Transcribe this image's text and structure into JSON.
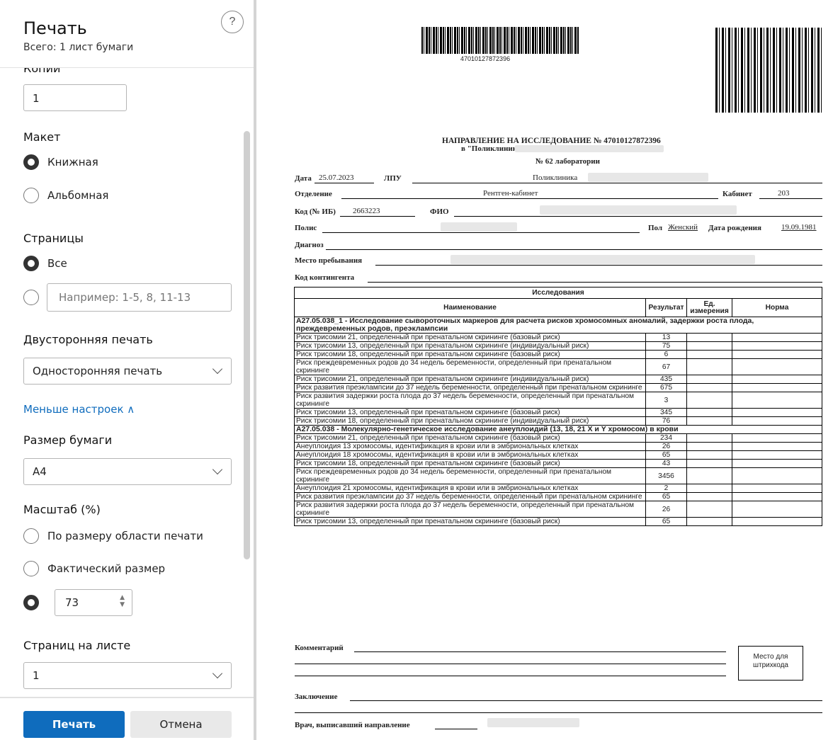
{
  "dialog": {
    "title": "Печать",
    "subtitle": "Всего: 1 лист бумаги",
    "help": "?",
    "copies_label": "Копии",
    "copies_value": "1",
    "layout_label": "Макет",
    "layout_options": [
      "Книжная",
      "Альбомная"
    ],
    "pages_label": "Страницы",
    "pages_all": "Все",
    "pages_placeholder": "Например: 1-5, 8, 11-13",
    "duplex_label": "Двусторонняя печать",
    "duplex_value": "Односторонняя печать",
    "less_settings": "Меньше настроек ∧",
    "paper_label": "Размер бумаги",
    "paper_value": "A4",
    "scale_label": "Масштаб (%)",
    "scale_fit": "По размеру области печати",
    "scale_actual": "Фактический размер",
    "scale_value": "73",
    "pps_label": "Страниц на листе",
    "pps_value": "1",
    "print_button": "Печать",
    "cancel_button": "Отмена"
  },
  "document": {
    "barcode_number": "47010127872396",
    "heading": "НАПРАВЛЕНИЕ НА ИССЛЕДОВАНИЕ № 47010127872396",
    "heading_to": "в \"Поликлиника",
    "lab": "№ 62 лаборатории",
    "date_label": "Дата",
    "date_value": "25.07.2023",
    "lpu_label": "ЛПУ",
    "lpu_value": "Поликлиника",
    "dept_label": "Отделение",
    "dept_value": "Рентген-кабинет",
    "cabinet_label": "Кабинет",
    "cabinet_value": "203",
    "code_label": "Код (№ ИБ)",
    "code_value": "2663223",
    "fio_label": "ФИО",
    "policy_label": "Полис",
    "sex_label": "Пол",
    "sex_value": "Женский",
    "dob_label": "Дата рождения",
    "dob_value": "19.09.1981",
    "diagnosis_label": "Диагноз",
    "stay_label": "Место пребывания",
    "contingent_label": "Код контингента",
    "table_title": "Исследования",
    "col_name": "Наименование",
    "col_result": "Результат",
    "col_unit": "Ед. измерения",
    "col_norm": "Норма",
    "groups": [
      {
        "title": "A27.05.038_1 - Исследование сывороточных маркеров для расчета рисков хромосомных аномалий, задержки роста плода, преждевременных родов, преэклампсии",
        "rows": [
          {
            "name": "Риск трисомии 21, определенный при пренатальном скрининге (базовый риск)",
            "result": "13"
          },
          {
            "name": "Риск трисомии 13, определенный при пренатальном скрининге (индивидуальный риск)",
            "result": "75"
          },
          {
            "name": "Риск трисомии 18, определенный при пренатальном скрининге (базовый риск)",
            "result": "6"
          },
          {
            "name": "Риск преждевременных родов до 34 недель беременности, определенный при пренатальном скрининге",
            "result": "67"
          },
          {
            "name": "Риск трисомии 21, определенный при пренатальном скрининге (индивидуальный риск)",
            "result": "435"
          },
          {
            "name": "Риск развития преэклампсии до 37 недель беременности, определенный при пренатальном скрининге",
            "result": "675"
          },
          {
            "name": "Риск развития задержки роста плода до 37 недель беременности, определенный при пренатальном скрининге",
            "result": "3"
          },
          {
            "name": "Риск трисомии 13, определенный при пренатальном скрининге (базовый риск)",
            "result": "345"
          },
          {
            "name": "Риск трисомии 18, определенный при пренатальном скрининге (индивидуальный риск)",
            "result": "76"
          }
        ]
      },
      {
        "title": "A27.05.038 - Молекулярно-генетическое исследование анеуплоидий (13, 18, 21 X и Y хромосом) в крови",
        "rows": [
          {
            "name": "Риск трисомии 21, определенный при пренатальном скрининге (базовый риск)",
            "result": "234"
          },
          {
            "name": "Анеуплоидия 13 хромосомы, идентификация в крови или в эмбриональных клетках",
            "result": "26"
          },
          {
            "name": "Анеуплоидия 18 хромосомы, идентификация в крови или в эмбриональных клетках",
            "result": "65"
          },
          {
            "name": "Риск трисомии 18, определенный при пренатальном скрининге (базовый риск)",
            "result": "43"
          },
          {
            "name": "Риск преждевременных родов до 34 недель беременности, определенный при пренатальном скрининге",
            "result": "3456"
          },
          {
            "name": "Анеуплоидия 21 хромосомы, идентификация в крови или в эмбриональных клетках",
            "result": "2"
          },
          {
            "name": "Риск развития преэклампсии до 37 недель беременности, определенный при пренатальном скрининге",
            "result": "65"
          },
          {
            "name": "Риск развития задержки роста плода до 37 недель беременности, определенный при пренатальном скрининге",
            "result": "26"
          },
          {
            "name": "Риск трисомии 13, определенный при пренатальном скрининге (базовый риск)",
            "result": "65"
          }
        ]
      }
    ],
    "comment_label": "Комментарий",
    "barcode_place": "Место для штрихкода",
    "conclusion_label": "Заключение",
    "doctor_label": "Врач, выписавший направление"
  }
}
